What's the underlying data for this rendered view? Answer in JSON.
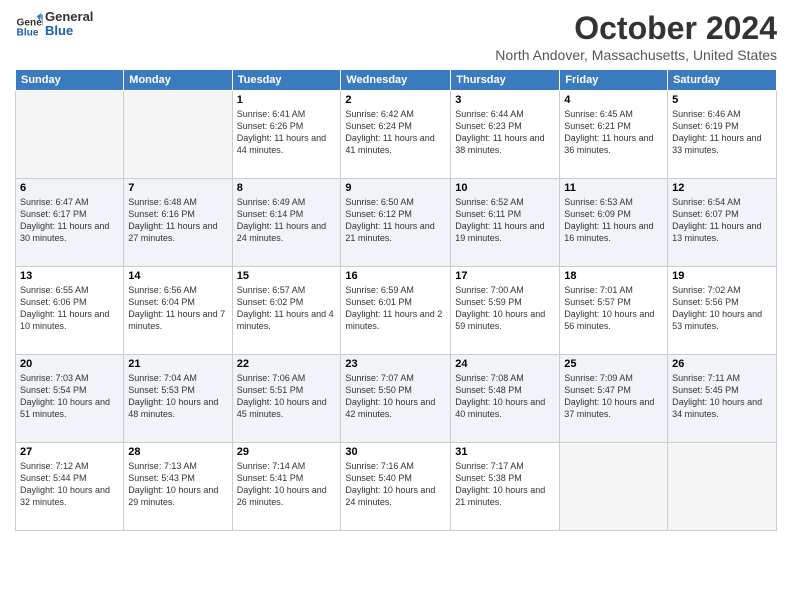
{
  "logo": {
    "general": "General",
    "blue": "Blue"
  },
  "header": {
    "title": "October 2024",
    "subtitle": "North Andover, Massachusetts, United States"
  },
  "days_of_week": [
    "Sunday",
    "Monday",
    "Tuesday",
    "Wednesday",
    "Thursday",
    "Friday",
    "Saturday"
  ],
  "weeks": [
    [
      {
        "num": "",
        "info": ""
      },
      {
        "num": "",
        "info": ""
      },
      {
        "num": "1",
        "info": "Sunrise: 6:41 AM\nSunset: 6:26 PM\nDaylight: 11 hours and 44 minutes."
      },
      {
        "num": "2",
        "info": "Sunrise: 6:42 AM\nSunset: 6:24 PM\nDaylight: 11 hours and 41 minutes."
      },
      {
        "num": "3",
        "info": "Sunrise: 6:44 AM\nSunset: 6:23 PM\nDaylight: 11 hours and 38 minutes."
      },
      {
        "num": "4",
        "info": "Sunrise: 6:45 AM\nSunset: 6:21 PM\nDaylight: 11 hours and 36 minutes."
      },
      {
        "num": "5",
        "info": "Sunrise: 6:46 AM\nSunset: 6:19 PM\nDaylight: 11 hours and 33 minutes."
      }
    ],
    [
      {
        "num": "6",
        "info": "Sunrise: 6:47 AM\nSunset: 6:17 PM\nDaylight: 11 hours and 30 minutes."
      },
      {
        "num": "7",
        "info": "Sunrise: 6:48 AM\nSunset: 6:16 PM\nDaylight: 11 hours and 27 minutes."
      },
      {
        "num": "8",
        "info": "Sunrise: 6:49 AM\nSunset: 6:14 PM\nDaylight: 11 hours and 24 minutes."
      },
      {
        "num": "9",
        "info": "Sunrise: 6:50 AM\nSunset: 6:12 PM\nDaylight: 11 hours and 21 minutes."
      },
      {
        "num": "10",
        "info": "Sunrise: 6:52 AM\nSunset: 6:11 PM\nDaylight: 11 hours and 19 minutes."
      },
      {
        "num": "11",
        "info": "Sunrise: 6:53 AM\nSunset: 6:09 PM\nDaylight: 11 hours and 16 minutes."
      },
      {
        "num": "12",
        "info": "Sunrise: 6:54 AM\nSunset: 6:07 PM\nDaylight: 11 hours and 13 minutes."
      }
    ],
    [
      {
        "num": "13",
        "info": "Sunrise: 6:55 AM\nSunset: 6:06 PM\nDaylight: 11 hours and 10 minutes."
      },
      {
        "num": "14",
        "info": "Sunrise: 6:56 AM\nSunset: 6:04 PM\nDaylight: 11 hours and 7 minutes."
      },
      {
        "num": "15",
        "info": "Sunrise: 6:57 AM\nSunset: 6:02 PM\nDaylight: 11 hours and 4 minutes."
      },
      {
        "num": "16",
        "info": "Sunrise: 6:59 AM\nSunset: 6:01 PM\nDaylight: 11 hours and 2 minutes."
      },
      {
        "num": "17",
        "info": "Sunrise: 7:00 AM\nSunset: 5:59 PM\nDaylight: 10 hours and 59 minutes."
      },
      {
        "num": "18",
        "info": "Sunrise: 7:01 AM\nSunset: 5:57 PM\nDaylight: 10 hours and 56 minutes."
      },
      {
        "num": "19",
        "info": "Sunrise: 7:02 AM\nSunset: 5:56 PM\nDaylight: 10 hours and 53 minutes."
      }
    ],
    [
      {
        "num": "20",
        "info": "Sunrise: 7:03 AM\nSunset: 5:54 PM\nDaylight: 10 hours and 51 minutes."
      },
      {
        "num": "21",
        "info": "Sunrise: 7:04 AM\nSunset: 5:53 PM\nDaylight: 10 hours and 48 minutes."
      },
      {
        "num": "22",
        "info": "Sunrise: 7:06 AM\nSunset: 5:51 PM\nDaylight: 10 hours and 45 minutes."
      },
      {
        "num": "23",
        "info": "Sunrise: 7:07 AM\nSunset: 5:50 PM\nDaylight: 10 hours and 42 minutes."
      },
      {
        "num": "24",
        "info": "Sunrise: 7:08 AM\nSunset: 5:48 PM\nDaylight: 10 hours and 40 minutes."
      },
      {
        "num": "25",
        "info": "Sunrise: 7:09 AM\nSunset: 5:47 PM\nDaylight: 10 hours and 37 minutes."
      },
      {
        "num": "26",
        "info": "Sunrise: 7:11 AM\nSunset: 5:45 PM\nDaylight: 10 hours and 34 minutes."
      }
    ],
    [
      {
        "num": "27",
        "info": "Sunrise: 7:12 AM\nSunset: 5:44 PM\nDaylight: 10 hours and 32 minutes."
      },
      {
        "num": "28",
        "info": "Sunrise: 7:13 AM\nSunset: 5:43 PM\nDaylight: 10 hours and 29 minutes."
      },
      {
        "num": "29",
        "info": "Sunrise: 7:14 AM\nSunset: 5:41 PM\nDaylight: 10 hours and 26 minutes."
      },
      {
        "num": "30",
        "info": "Sunrise: 7:16 AM\nSunset: 5:40 PM\nDaylight: 10 hours and 24 minutes."
      },
      {
        "num": "31",
        "info": "Sunrise: 7:17 AM\nSunset: 5:38 PM\nDaylight: 10 hours and 21 minutes."
      },
      {
        "num": "",
        "info": ""
      },
      {
        "num": "",
        "info": ""
      }
    ]
  ]
}
